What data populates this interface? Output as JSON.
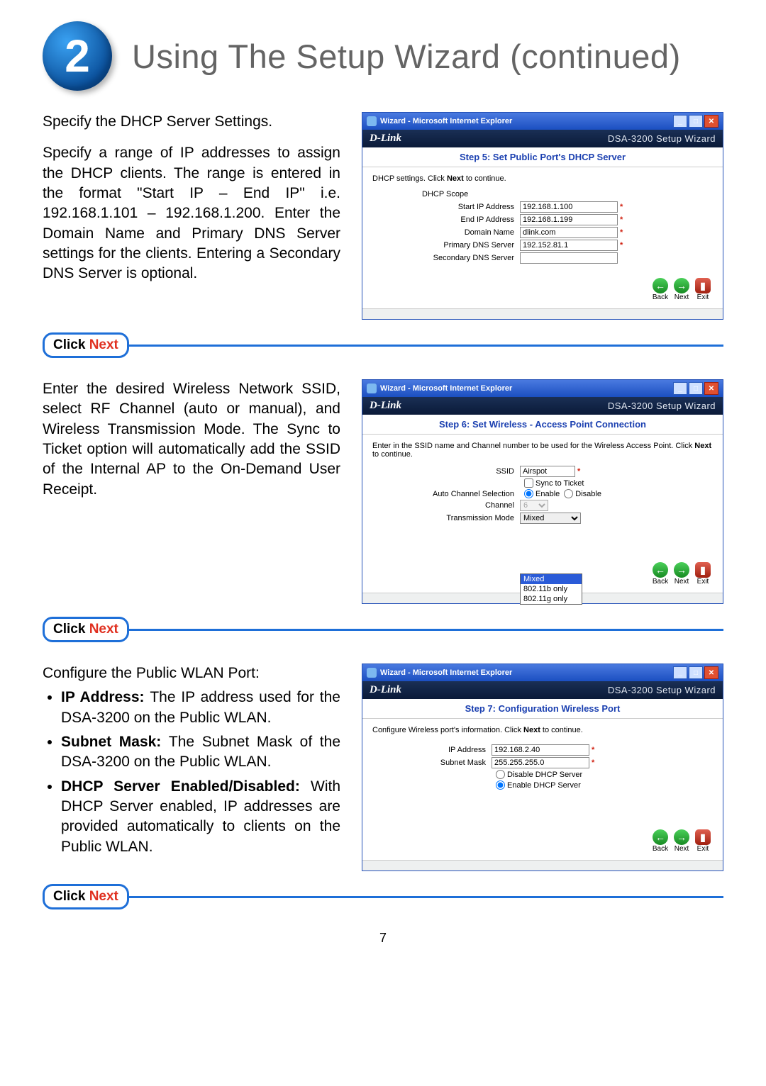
{
  "header": {
    "badge": "2",
    "title": "Using The Setup Wizard (continued)"
  },
  "click_pill": {
    "click": "Click ",
    "next": "Next"
  },
  "section1": {
    "intro": "Specify the DHCP Server Settings.",
    "body": "Specify a range of IP addresses to assign the DHCP clients. The range is entered in the format \"Start IP – End IP\" i.e. 192.168.1.101 – 192.168.1.200. Enter the Domain Name and Primary DNS Server settings for the clients. Entering a Secondary DNS Server is optional."
  },
  "wizard_common": {
    "window_title": "Wizard - Microsoft Internet Explorer",
    "brand": "D-Link",
    "subtitle": "DSA-3200 Setup Wizard",
    "nav": {
      "back": "Back",
      "next": "Next",
      "exit": "Exit"
    }
  },
  "wizard1": {
    "step": "Step 5: Set Public Port's DHCP Server",
    "hint_a": "DHCP settings. Click ",
    "hint_b": "Next",
    "hint_c": " to continue.",
    "scope": "DHCP Scope",
    "labels": {
      "start_ip": "Start IP Address",
      "end_ip": "End IP Address",
      "domain": "Domain Name",
      "pdns": "Primary DNS Server",
      "sdns": "Secondary DNS Server"
    },
    "values": {
      "start_ip": "192.168.1.100",
      "end_ip": "192.168.1.199",
      "domain": "dlink.com",
      "pdns": "192.152.81.1",
      "sdns": ""
    }
  },
  "section2": {
    "body": "Enter the desired Wireless Network SSID, select RF Channel (auto or manual), and Wireless Transmission Mode.  The Sync to Ticket option will automatically add the SSID of the Internal AP to the On-Demand User Receipt."
  },
  "wizard2": {
    "step": "Step 6: Set Wireless - Access Point Connection",
    "hint_a": "Enter in the SSID name and Channel number to be used for the Wireless Access Point. Click ",
    "hint_b": "Next",
    "hint_c": " to continue.",
    "labels": {
      "ssid": "SSID",
      "sync": "Sync to Ticket",
      "auto_ch": "Auto Channel Selection",
      "enable": "Enable",
      "disable": "Disable",
      "channel": "Channel",
      "tmode": "Transmission Mode"
    },
    "values": {
      "ssid": "Airspot",
      "channel": "6",
      "tmode": "Mixed",
      "tmode_options": [
        "Mixed",
        "802.11b only",
        "802.11g only"
      ]
    }
  },
  "section3": {
    "intro": "Configure the Public WLAN Port:",
    "b1_label": "IP Address: ",
    "b1_text": "The IP address used for the DSA-3200 on the Public WLAN.",
    "b2_label": "Subnet Mask: ",
    "b2_text": "The Subnet Mask of the DSA-3200 on the Public WLAN.",
    "b3_label": "DHCP Server Enabled/Disabled: ",
    "b3_text": "With DHCP Server enabled, IP addresses are provided automatically to clients on the Public WLAN."
  },
  "wizard3": {
    "step": "Step 7: Configuration Wireless Port",
    "hint_a": "Configure Wireless port's information. Click ",
    "hint_b": "Next",
    "hint_c": " to continue.",
    "labels": {
      "ip": "IP Address",
      "mask": "Subnet Mask",
      "disable_dhcp": "Disable DHCP Server",
      "enable_dhcp": "Enable DHCP Server"
    },
    "values": {
      "ip": "192.168.2.40",
      "mask": "255.255.255.0"
    }
  },
  "page_number": "7"
}
